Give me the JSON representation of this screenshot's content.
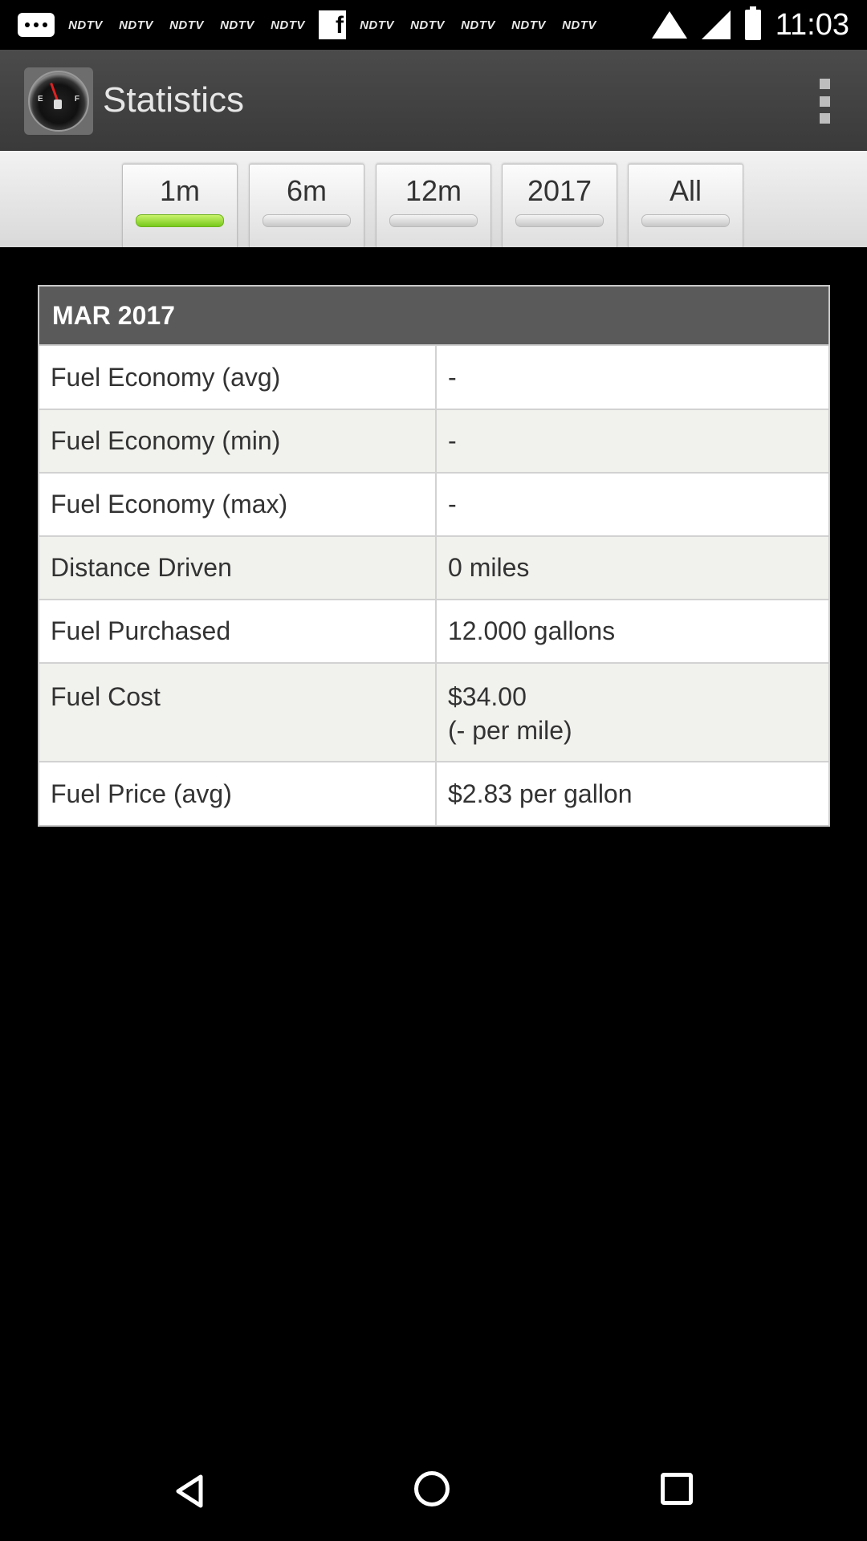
{
  "status_bar": {
    "time": "11:03",
    "notifications": [
      "NDTV",
      "NDTV",
      "NDTV",
      "NDTV",
      "NDTV",
      "f",
      "NDTV",
      "NDTV",
      "NDTV",
      "NDTV",
      "NDTV"
    ],
    "icons": [
      "message-icon",
      "wifi-icon",
      "signal-icon",
      "battery-icon"
    ]
  },
  "action_bar": {
    "title": "Statistics",
    "app_icon": "fuel-gauge-icon",
    "gauge_e": "E",
    "gauge_f": "F",
    "overflow_icon": "more-vert-icon"
  },
  "filter_tabs": [
    {
      "label": "1m",
      "active": true
    },
    {
      "label": "6m",
      "active": false
    },
    {
      "label": "12m",
      "active": false
    },
    {
      "label": "2017",
      "active": false
    },
    {
      "label": "All",
      "active": false
    }
  ],
  "stats": {
    "header": "MAR 2017",
    "rows": [
      {
        "label": "Fuel Economy (avg)",
        "value": "-"
      },
      {
        "label": "Fuel Economy (min)",
        "value": "-"
      },
      {
        "label": "Fuel Economy (max)",
        "value": "-"
      },
      {
        "label": "Distance Driven",
        "value": "0 miles"
      },
      {
        "label": "Fuel Purchased",
        "value": "12.000 gallons"
      },
      {
        "label": "Fuel Cost",
        "value": "$34.00",
        "value_line2": "(- per mile)"
      },
      {
        "label": "Fuel Price (avg)",
        "value": "$2.83 per gallon"
      }
    ]
  },
  "colors": {
    "active_indicator": "#77c81c",
    "header_bg": "#5a5a5a",
    "action_bar_bg": "#424242"
  },
  "nav_bar": [
    "back-icon",
    "home-icon",
    "recents-icon"
  ]
}
